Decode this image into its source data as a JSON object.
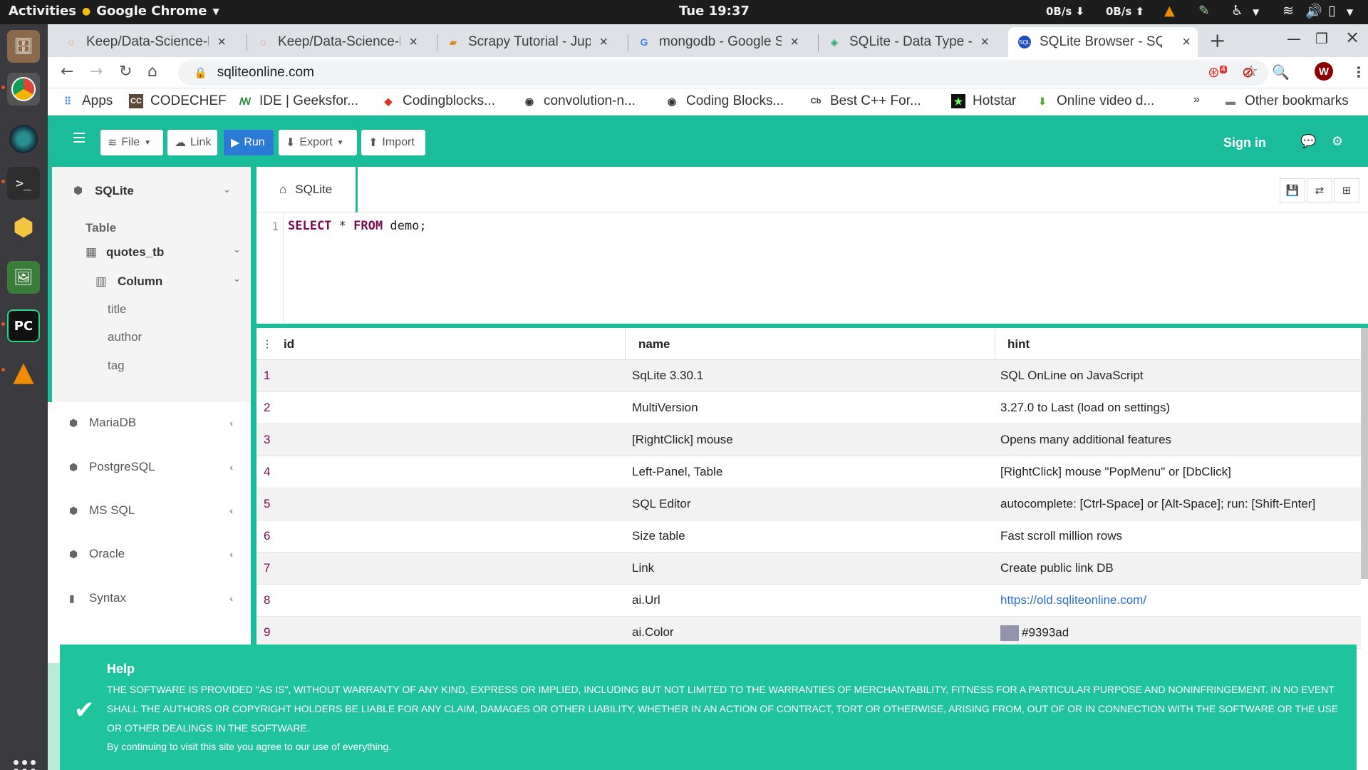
{
  "ubuntu": {
    "activities": "Activities",
    "app_name": "Google Chrome",
    "clock": "Tue 19:37",
    "net_down": "0B/s",
    "net_up": "0B/s"
  },
  "chrome": {
    "tabs": [
      {
        "title": "Keep/Data-Science-M",
        "icon": "ring-favicon"
      },
      {
        "title": "Keep/Data-Science-M",
        "icon": "ring-favicon"
      },
      {
        "title": "Scrapy Tutorial - Jupy",
        "icon": "book-favicon"
      },
      {
        "title": "mongodb - Google Se",
        "icon": "google-favicon"
      },
      {
        "title": "SQLite - Data Type - T",
        "icon": "diamond-favicon"
      },
      {
        "title": "SQLite Browser - SQL",
        "icon": "sql-favicon"
      }
    ],
    "url": "sqliteonline.com",
    "ext_badge": "4",
    "profile_initial": "W",
    "bookmarks": [
      {
        "label": "Apps"
      },
      {
        "label": "CODECHEF"
      },
      {
        "label": "IDE | Geeksfor..."
      },
      {
        "label": "Codingblocks..."
      },
      {
        "label": "convolution-n..."
      },
      {
        "label": "Coding Blocks..."
      },
      {
        "label": "Best C++ For..."
      },
      {
        "label": "Hotstar"
      },
      {
        "label": "Online video d..."
      }
    ],
    "bookmarks_overflow": "»",
    "other_bookmarks": "Other bookmarks"
  },
  "toolbar": {
    "file": "File",
    "link": "Link",
    "run": "Run",
    "export": "Export",
    "import": "Import",
    "sign_in": "Sign in"
  },
  "sidebar": {
    "db_title": "SQLite",
    "table_header": "Table",
    "table_name": "quotes_tb",
    "column_header": "Column",
    "columns": [
      "title",
      "author",
      "tag"
    ],
    "other_dbs": [
      "MariaDB",
      "PostgreSQL",
      "MS SQL",
      "Oracle",
      "Syntax"
    ]
  },
  "editor": {
    "tab_label": "SQLite",
    "line_number": "1",
    "kw_select": "SELECT",
    "star": "*",
    "kw_from": "FROM",
    "table": "demo;"
  },
  "results": {
    "headers": [
      "id",
      "name",
      "hint"
    ],
    "rows": [
      {
        "id": "1",
        "name": "SqLite 3.30.1",
        "hint": "SQL OnLine on JavaScript"
      },
      {
        "id": "2",
        "name": "MultiVersion",
        "hint": "3.27.0 to Last (load on settings)"
      },
      {
        "id": "3",
        "name": "[RightClick] mouse",
        "hint": "Opens many additional features"
      },
      {
        "id": "4",
        "name": "Left-Panel, Table",
        "hint": "[RightClick] mouse \"PopMenu\" or [DbClick]"
      },
      {
        "id": "5",
        "name": "SQL Editor",
        "hint": "autocomplete: [Ctrl-Space] or [Alt-Space]; run: [Shift-Enter]"
      },
      {
        "id": "6",
        "name": "Size table",
        "hint": "Fast scroll million rows"
      },
      {
        "id": "7",
        "name": "Link",
        "hint": "Create public link DB"
      },
      {
        "id": "8",
        "name": "ai.Url",
        "hint": "https://old.sqliteonline.com/"
      },
      {
        "id": "9",
        "name": "ai.Color",
        "hint": "#9393ad",
        "swatch": "#9393ad"
      }
    ]
  },
  "help": {
    "title": "Help",
    "body": "THE SOFTWARE IS PROVIDED \"AS IS\", WITHOUT WARRANTY OF ANY KIND, EXPRESS OR IMPLIED, INCLUDING BUT NOT LIMITED TO THE WARRANTIES OF MERCHANTABILITY, FITNESS FOR A PARTICULAR PURPOSE AND NONINFRINGEMENT. IN NO EVENT SHALL THE AUTHORS OR COPYRIGHT HOLDERS BE LIABLE FOR ANY CLAIM, DAMAGES OR OTHER LIABILITY, WHETHER IN AN ACTION OF CONTRACT, TORT OR OTHERWISE, ARISING FROM, OUT OF OR IN CONNECTION WITH THE SOFTWARE OR THE USE OR OTHER DEALINGS IN THE SOFTWARE.",
    "footer": "By continuing to visit this site you agree to our use of everything."
  },
  "colors": {
    "accent": "#1abc9c",
    "run_button": "#2b7bd6",
    "id_text": "#7a0a4f",
    "link": "#2a6fc9"
  }
}
